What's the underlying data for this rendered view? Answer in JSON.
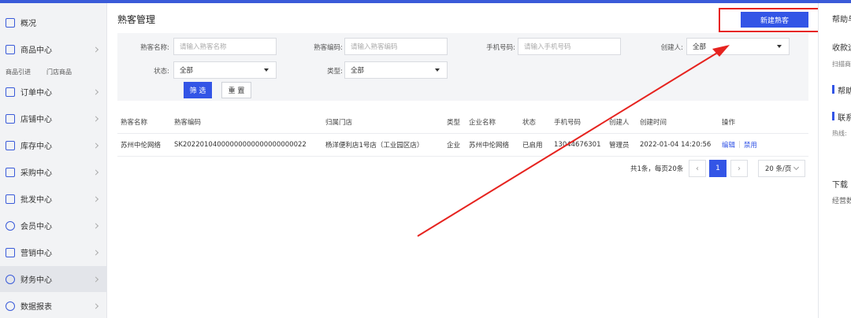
{
  "sidebar": {
    "items": [
      {
        "label": "概况",
        "icon": "home-icon"
      },
      {
        "label": "商品中心",
        "icon": "product-icon"
      },
      {
        "label": "订单中心",
        "icon": "order-icon"
      },
      {
        "label": "店铺中心",
        "icon": "store-icon"
      },
      {
        "label": "库存中心",
        "icon": "inventory-icon"
      },
      {
        "label": "采购中心",
        "icon": "purchase-icon"
      },
      {
        "label": "批发中心",
        "icon": "wholesale-icon"
      },
      {
        "label": "会员中心",
        "icon": "member-icon"
      },
      {
        "label": "营销中心",
        "icon": "marketing-icon"
      },
      {
        "label": "财务中心",
        "icon": "finance-icon"
      },
      {
        "label": "数据报表",
        "icon": "report-icon"
      }
    ],
    "sub_items": [
      "商品引进",
      "门店商品"
    ]
  },
  "page": {
    "title": "熟客管理",
    "new_button": "新建熟客"
  },
  "filters": {
    "name_label": "熟客名称:",
    "name_placeholder": "请输入熟客名称",
    "code_label": "熟客编码:",
    "code_placeholder": "请输入熟客编码",
    "phone_label": "手机号码:",
    "phone_placeholder": "请输入手机号码",
    "creator_label": "创建人:",
    "creator_value": "全部",
    "status_label": "状态:",
    "status_value": "全部",
    "type_label": "类型:",
    "type_value": "全部",
    "filter_button": "筛 选",
    "reset_button": "重 置"
  },
  "table": {
    "headers": [
      "熟客名称",
      "熟客编码",
      "归属门店",
      "类型",
      "企业名称",
      "状态",
      "手机号码",
      "创建人",
      "创建时间",
      "操作"
    ],
    "rows": [
      {
        "name": "苏州中伦网络",
        "code": "SK20220104000000000000000000022",
        "store": "杨洋便利店1号店（工业园区店）",
        "type": "企业",
        "company": "苏州中伦网络",
        "status": "已启用",
        "phone": "13044676301",
        "creator": "管理员",
        "created": "2022-01-04 14:20:56",
        "edit": "编辑",
        "disable": "禁用"
      }
    ]
  },
  "pagination": {
    "info": "共1条，每页20条",
    "current_page": "1",
    "page_size": "20 条/页"
  },
  "help": {
    "title": "帮助与",
    "line1": "收款运",
    "line2": "扫描商",
    "section1": "帮助",
    "section2": "联系",
    "hotline": "热线:",
    "download": "下载",
    "business": "经营数"
  },
  "colors": {
    "accent": "#3355e6",
    "annotation": "#e6231f"
  }
}
